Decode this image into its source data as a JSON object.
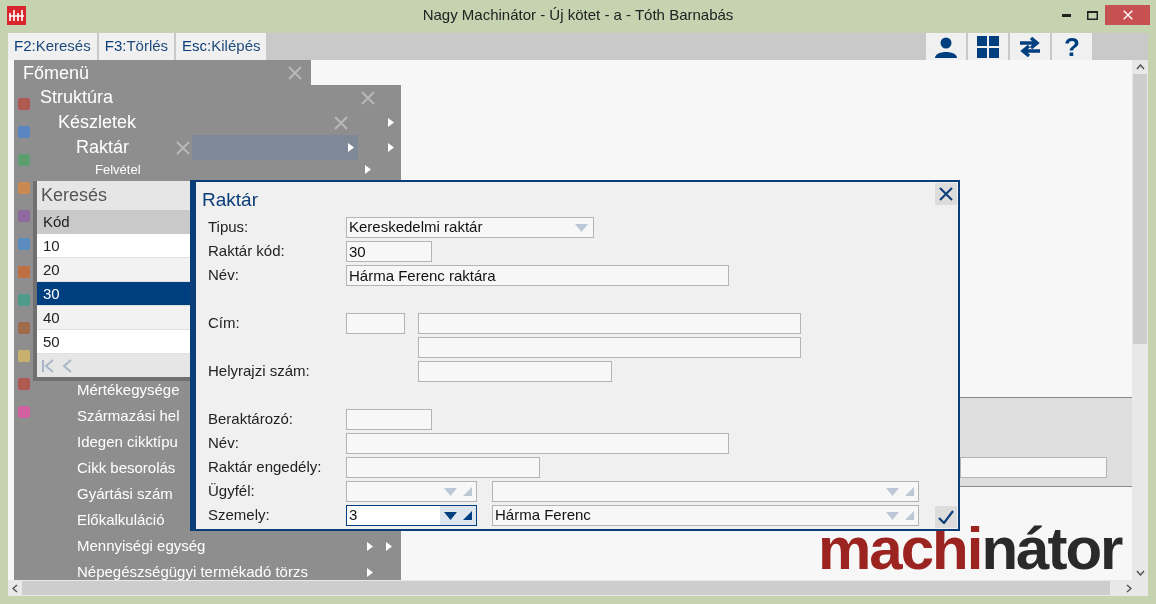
{
  "window": {
    "title": "Nagy Machinátor - Új kötet - a - Tóth Barnabás"
  },
  "toolbar": {
    "keys": [
      {
        "key": "F2:",
        "label": "Keresés"
      },
      {
        "key": "F3:",
        "label": "Törlés"
      },
      {
        "key": "Esc:",
        "label": "Kilépés"
      }
    ],
    "help": "?"
  },
  "menu": {
    "root": "Főmenü",
    "levels": [
      {
        "title": "Struktúra",
        "submenu": false
      },
      {
        "title": "Készletek",
        "submenu": true
      },
      {
        "title": "Raktár",
        "submenu": true
      }
    ],
    "top_items": [
      {
        "label": "Felvétel",
        "submenu": true
      }
    ],
    "items": [
      {
        "label": "Mértékegysége",
        "submenu": false,
        "outer": false
      },
      {
        "label": "Származási hel",
        "submenu": false,
        "outer": false
      },
      {
        "label": "Idegen cikktípu",
        "submenu": false,
        "outer": false
      },
      {
        "label": "Cikk besorolás",
        "submenu": false,
        "outer": false
      },
      {
        "label": "Gyártási szám",
        "submenu": false,
        "outer": false
      },
      {
        "label": "Előkalkuláció",
        "submenu": false,
        "outer": false
      },
      {
        "label": "Mennyiségi egység",
        "submenu": true,
        "outer": true
      },
      {
        "label": "Népegészségügyi termékadó törzs",
        "submenu": true,
        "outer": false
      }
    ]
  },
  "search": {
    "title": "Keresés",
    "column": "Kód",
    "rows": [
      {
        "code": "10",
        "selected": false
      },
      {
        "code": "20",
        "selected": false
      },
      {
        "code": "30",
        "selected": true
      },
      {
        "code": "40",
        "selected": false
      },
      {
        "code": "50",
        "selected": false
      }
    ]
  },
  "dialog": {
    "title": "Raktár",
    "groups": [
      [
        {
          "kind": "select",
          "label": "Tipus:",
          "value": "Kereskedelmi raktár"
        },
        {
          "kind": "short",
          "label": "Raktár kód:",
          "value": "30"
        },
        {
          "kind": "long",
          "label": "Név:",
          "value": "Hárma Ferenc raktára"
        }
      ],
      [
        {
          "kind": "address",
          "label": "Cím:"
        },
        {
          "kind": "address2"
        },
        {
          "kind": "parcel",
          "label": "Helyrajzi szám:"
        }
      ],
      [
        {
          "kind": "short",
          "label": "Beraktározó:"
        },
        {
          "kind": "long",
          "label": "Név:"
        },
        {
          "kind": "medium",
          "label": "Raktár engedély:"
        },
        {
          "kind": "combo",
          "label": "Ügyfél:",
          "focused": false
        },
        {
          "kind": "combo",
          "label": "Szemely:",
          "value": "3",
          "name": "Hárma Ferenc",
          "focused": true
        }
      ]
    ]
  },
  "logo": {
    "red": "machi",
    "dark": "nátor"
  }
}
